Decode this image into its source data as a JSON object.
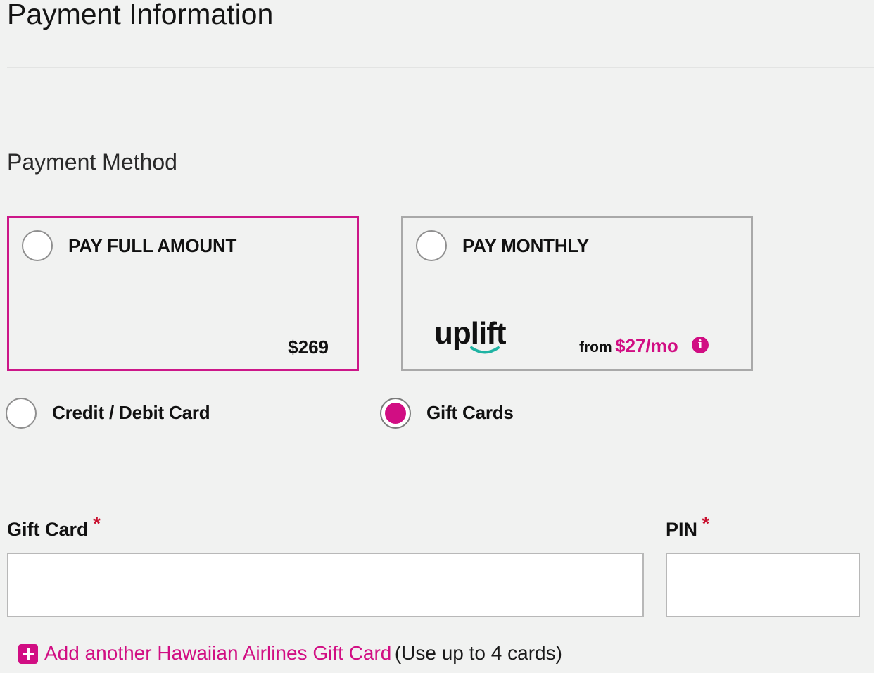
{
  "page": {
    "title": "Payment Information",
    "section_label": "Payment Method"
  },
  "options": {
    "full": {
      "label": "PAY FULL AMOUNT",
      "price": "$269"
    },
    "monthly": {
      "label": "PAY MONTHLY",
      "logo_text": "uplift",
      "from_label": "from",
      "from_amount": "$27/mo",
      "info_icon": "i"
    }
  },
  "methods": {
    "credit": {
      "label": "Credit / Debit Card",
      "selected": false
    },
    "gift": {
      "label": "Gift Cards",
      "selected": true
    }
  },
  "form": {
    "gift_card_label": "Gift Card",
    "pin_label": "PIN",
    "required_mark": "*",
    "gift_card_value": "",
    "pin_value": ""
  },
  "add_card": {
    "link_text": "Add another Hawaiian Airlines Gift Card",
    "note": "(Use up to 4 cards)"
  },
  "colors": {
    "accent": "#d10e83",
    "required": "#c8102e",
    "uplift_smile": "#1fb3a3"
  },
  "icons": [
    "radio-icon",
    "uplift-logo",
    "info-icon",
    "required-asterisk",
    "plus-icon"
  ]
}
